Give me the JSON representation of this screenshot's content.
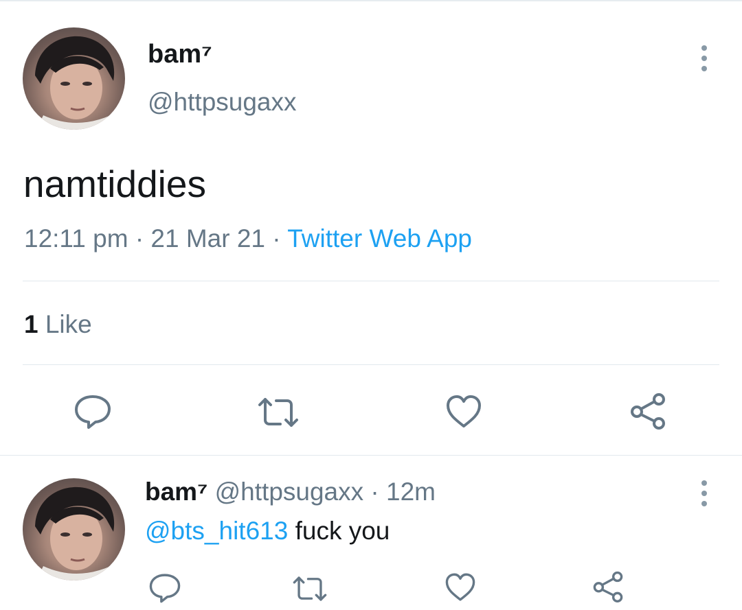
{
  "main_tweet": {
    "display_name": "bam⁷",
    "handle": "@httpsugaxx",
    "text": "namtiddies",
    "time": "12:11 pm",
    "date": "21 Mar 21",
    "separator": "·",
    "source": "Twitter Web App",
    "likes_count": "1",
    "likes_label": "Like"
  },
  "reply": {
    "display_name": "bam⁷",
    "handle": "@httpsugaxx",
    "separator": "·",
    "age": "12m",
    "mention": "@bts_hit613",
    "text": "fuck you"
  },
  "icons": {
    "reply": "reply-icon",
    "retweet": "retweet-icon",
    "like": "heart-icon",
    "share": "share-icon",
    "more": "more-vertical-icon"
  },
  "colors": {
    "text_primary": "#14171a",
    "text_secondary": "#657786",
    "link": "#1da1f2",
    "icon": "#657786",
    "divider": "#e1e8ed"
  }
}
